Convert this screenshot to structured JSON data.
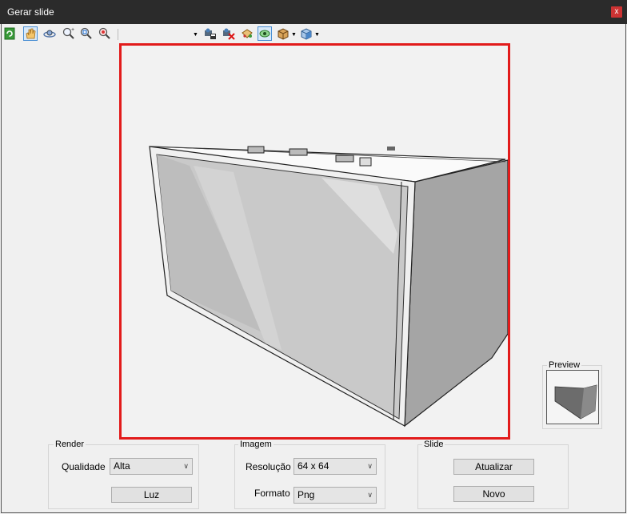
{
  "window": {
    "title": "Gerar slide",
    "close_label": "x"
  },
  "toolbar": {
    "left_icons": [
      "refresh-icon",
      "pan-hand-icon",
      "orbit-icon",
      "zoom-in-icon",
      "zoom-extents-icon",
      "zoom-window-icon"
    ],
    "right_icons": [
      "camera-save-icon",
      "camera-delete-icon",
      "paint-bucket-icon",
      "eye-view-icon",
      "box-3d-icon",
      "view-cube-icon"
    ]
  },
  "preview": {
    "label": "Preview"
  },
  "render": {
    "group_label": "Render",
    "quality_label": "Qualidade",
    "quality_value": "Alta",
    "light_button": "Luz"
  },
  "image": {
    "group_label": "Imagem",
    "resolution_label": "Resolução",
    "resolution_value": "64 x 64",
    "format_label": "Formato",
    "format_value": "Png"
  },
  "slide": {
    "group_label": "Slide",
    "update_button": "Atualizar",
    "new_button": "Novo"
  },
  "colors": {
    "viewport_border": "#e21b1b",
    "titlebar": "#2b2b2b",
    "active_tool": "#4a8fd4"
  }
}
